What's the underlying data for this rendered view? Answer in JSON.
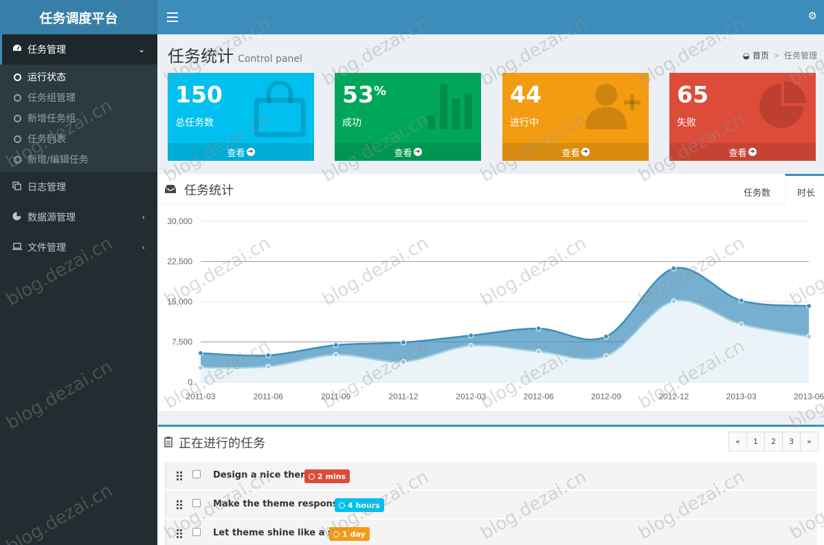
{
  "app": {
    "title": "任务调度平台"
  },
  "sidebar": {
    "groups": [
      {
        "label": "任务管理",
        "icon": "dashboard-icon",
        "active": true
      },
      {
        "label": "日志管理",
        "icon": "copy-icon"
      },
      {
        "label": "数据源管理",
        "icon": "pie-chart-icon"
      },
      {
        "label": "文件管理",
        "icon": "laptop-icon"
      }
    ],
    "sub_items": [
      "运行状态",
      "任务组管理",
      "新增任务组",
      "任务列表",
      "新增/编辑任务"
    ]
  },
  "header": {
    "title": "任务统计",
    "subtitle": "Control panel"
  },
  "breadcrumb": {
    "home": "首页",
    "current": "任务管理"
  },
  "stats": [
    {
      "value": "150",
      "suffix": "",
      "label": "总任务数",
      "link": "查看",
      "color": "#00c0ef",
      "icon": "shopping-bag-icon"
    },
    {
      "value": "53",
      "suffix": "%",
      "label": "成功",
      "link": "查看",
      "color": "#00a65a",
      "icon": "bar-chart-icon"
    },
    {
      "value": "44",
      "suffix": "",
      "label": "进行中",
      "link": "查看",
      "color": "#f39c12",
      "icon": "user-plus-icon"
    },
    {
      "value": "65",
      "suffix": "",
      "label": "失败",
      "link": "查看",
      "color": "#dd4b39",
      "icon": "pie-chart-icon"
    }
  ],
  "chart_panel": {
    "title": "任务统计",
    "tabs": [
      "任务数",
      "时长"
    ],
    "active_tab": "时长"
  },
  "chart_data": {
    "type": "area",
    "categories": [
      "2011-03",
      "2011-06",
      "2011-09",
      "2011-12",
      "2012-03",
      "2012-06",
      "2012-09",
      "2012-12",
      "2013-03",
      "2013-06"
    ],
    "x": [
      "2011 Q1",
      "2011 Q2",
      "2011 Q3",
      "2011 Q4",
      "2012 Q1",
      "2012 Q2",
      "2012 Q3",
      "2012 Q4",
      "2013 Q1",
      "2013 Q2"
    ],
    "series": [
      {
        "values": [
          5400,
          5000,
          6900,
          7400,
          8700,
          10000,
          8500,
          21200,
          15200,
          14200
        ],
        "color": "#3c8dbc"
      },
      {
        "values": [
          2700,
          2900,
          5100,
          3800,
          6800,
          5700,
          4900,
          15100,
          10800,
          8500
        ],
        "color": "#a0d0e0"
      }
    ],
    "yticks": [
      "0",
      "7,500",
      "15,000",
      "22,500",
      "30,000"
    ],
    "ylim": [
      0,
      30000
    ],
    "grid": true
  },
  "tasks_panel": {
    "title": "正在进行的任务",
    "pager": [
      "«",
      "1",
      "2",
      "3",
      "»"
    ],
    "items": [
      {
        "text": "Design a nice theme",
        "badge": "2 mins",
        "color": "#dd4b39"
      },
      {
        "text": "Make the theme responsive",
        "badge": "4 hours",
        "color": "#00c0ef"
      },
      {
        "text": "Let theme shine like a star",
        "badge": "1 day",
        "color": "#f39c12"
      }
    ]
  },
  "watermark": "blog.dezai.cn"
}
